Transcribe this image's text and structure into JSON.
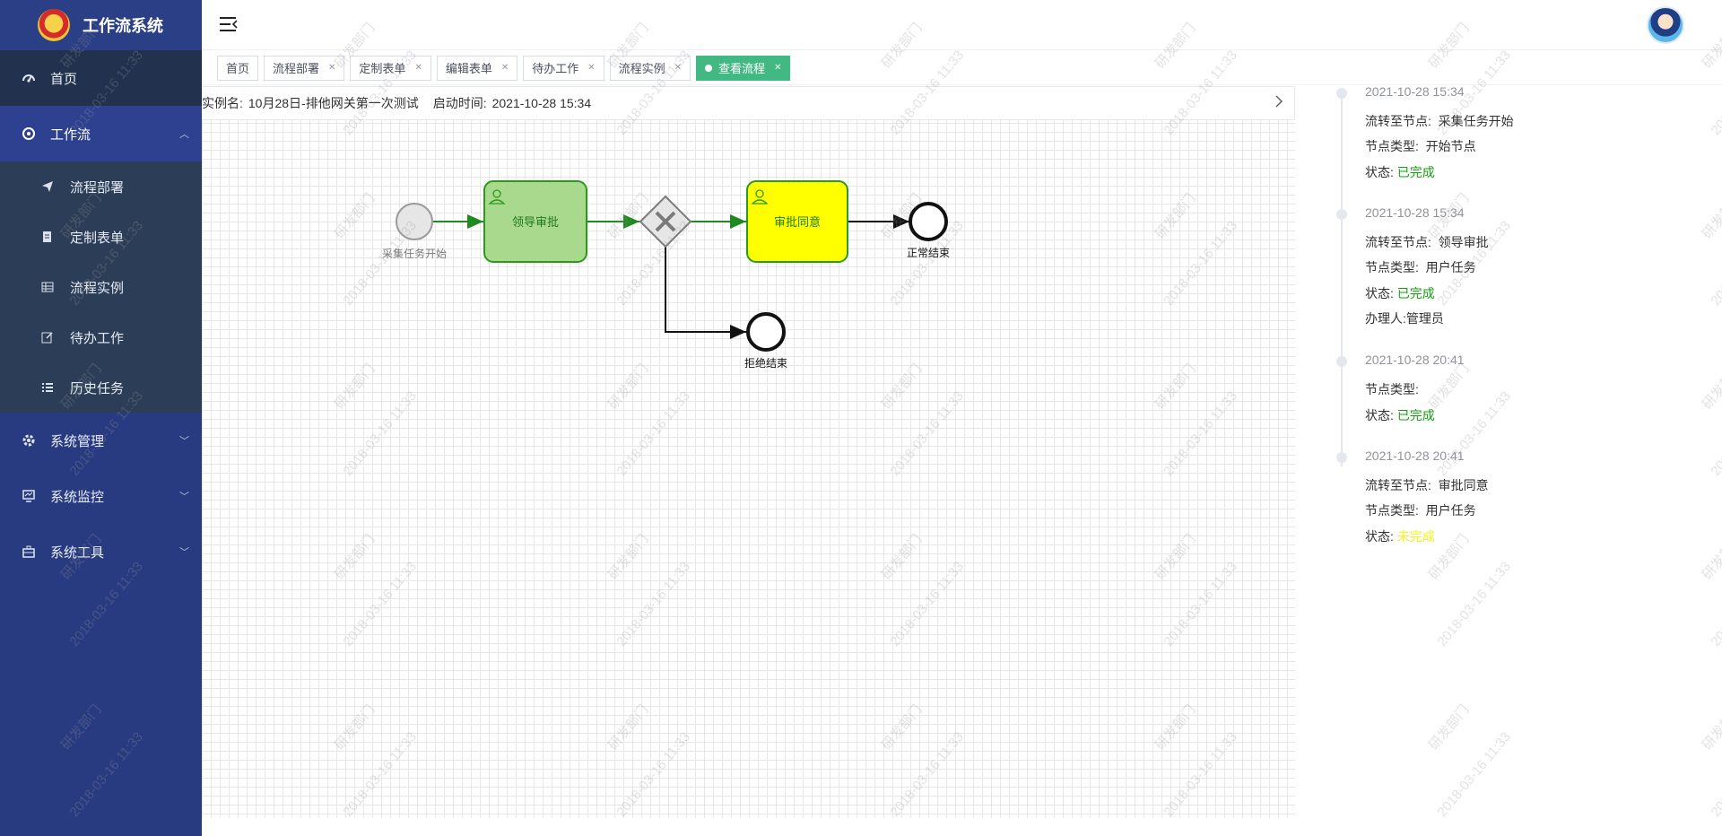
{
  "app": {
    "title": "工作流系统"
  },
  "sidebar": {
    "items": [
      {
        "label": "首页",
        "icon": "dashboard-icon"
      },
      {
        "label": "工作流",
        "icon": "workflow-icon",
        "expanded": true,
        "children": [
          {
            "label": "流程部署",
            "icon": "send-icon"
          },
          {
            "label": "定制表单",
            "icon": "form-icon"
          },
          {
            "label": "流程实例",
            "icon": "table-icon"
          },
          {
            "label": "待办工作",
            "icon": "edit-icon"
          },
          {
            "label": "历史任务",
            "icon": "list-icon"
          }
        ]
      },
      {
        "label": "系统管理",
        "icon": "gear-icon"
      },
      {
        "label": "系统监控",
        "icon": "monitor-icon"
      },
      {
        "label": "系统工具",
        "icon": "toolbox-icon"
      }
    ]
  },
  "tags": [
    {
      "label": "首页",
      "closable": false
    },
    {
      "label": "流程部署",
      "closable": true
    },
    {
      "label": "定制表单",
      "closable": true
    },
    {
      "label": "编辑表单",
      "closable": true
    },
    {
      "label": "待办工作",
      "closable": true
    },
    {
      "label": "流程实例",
      "closable": true
    },
    {
      "label": "查看流程",
      "closable": true,
      "active": true
    }
  ],
  "instance": {
    "name_label": "实例名:",
    "name_value": "10月28日-排他网关第一次测试",
    "start_label": "启动时间:",
    "start_value": "2021-10-28 15:34"
  },
  "diagram": {
    "start_label": "采集任务开始",
    "task1_label": "领导审批",
    "task2_label": "审批同意",
    "end_ok_label": "正常结束",
    "end_reject_label": "拒绝结束",
    "colors": {
      "done_fill": "#a8d98c",
      "done_stroke": "#2a9a1a",
      "current_fill": "#ffff00",
      "flow_done": "#1f8a1f",
      "flow_todo": "#111111"
    }
  },
  "timeline": [
    {
      "time": "2021-10-28 15:34",
      "rows": [
        {
          "label": "流转至节点:",
          "value": "采集任务开始"
        },
        {
          "label": "节点类型:",
          "value": "开始节点"
        },
        {
          "label": "状态:",
          "value": "已完成",
          "status": "done"
        }
      ]
    },
    {
      "time": "2021-10-28 15:34",
      "rows": [
        {
          "label": "流转至节点:",
          "value": "领导审批"
        },
        {
          "label": "节点类型:",
          "value": "用户任务"
        },
        {
          "label": "状态:",
          "value": "已完成",
          "status": "done"
        },
        {
          "label": "办理人:",
          "value": "管理员"
        }
      ]
    },
    {
      "time": "2021-10-28 20:41",
      "rows": [
        {
          "label": "节点类型:",
          "value": ""
        },
        {
          "label": "状态:",
          "value": "已完成",
          "status": "done"
        }
      ]
    },
    {
      "time": "2021-10-28 20:41",
      "rows": [
        {
          "label": "流转至节点:",
          "value": "审批同意"
        },
        {
          "label": "节点类型:",
          "value": "用户任务"
        },
        {
          "label": "状态:",
          "value": "未完成",
          "status": "pending"
        }
      ]
    }
  ],
  "watermark": {
    "line1": "研发部门",
    "line2": "2018-03-16 11:33"
  }
}
